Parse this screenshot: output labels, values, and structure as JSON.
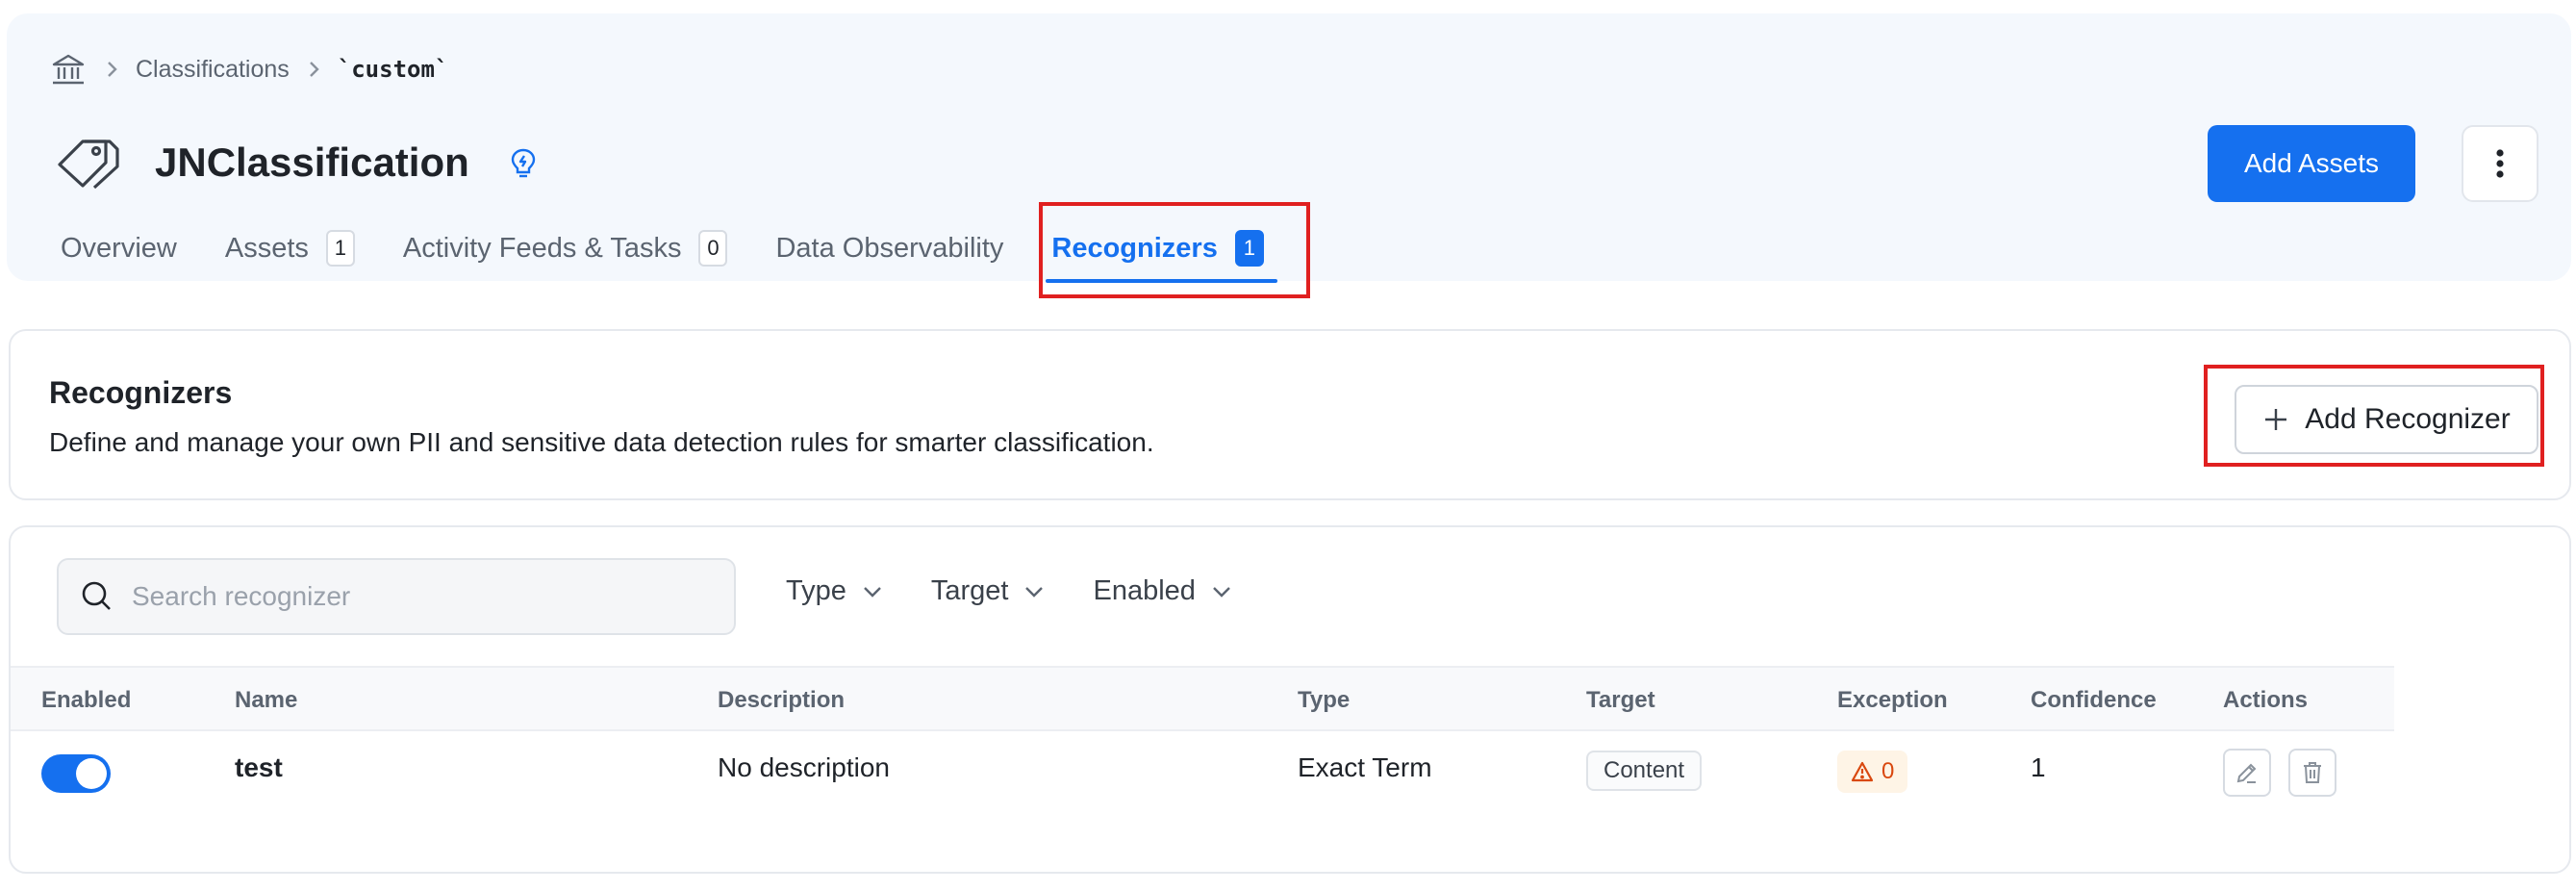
{
  "breadcrumb": {
    "items": [
      "Classifications"
    ],
    "current": "`custom`"
  },
  "page": {
    "title": "JNClassification"
  },
  "header": {
    "add_assets_label": "Add Assets"
  },
  "tabs": [
    {
      "label": "Overview"
    },
    {
      "label": "Assets",
      "count": "1"
    },
    {
      "label": "Activity Feeds & Tasks",
      "count": "0"
    },
    {
      "label": "Data Observability"
    },
    {
      "label": "Recognizers",
      "count": "1",
      "active": true
    }
  ],
  "recognizers_section": {
    "heading": "Recognizers",
    "description": "Define and manage your own PII and sensitive data detection rules for smarter classification.",
    "add_button_label": "Add Recognizer"
  },
  "search": {
    "placeholder": "Search recognizer",
    "value": ""
  },
  "filters": [
    {
      "label": "Type"
    },
    {
      "label": "Target"
    },
    {
      "label": "Enabled"
    }
  ],
  "table": {
    "columns": [
      "Enabled",
      "Name",
      "Description",
      "Type",
      "Target",
      "Exception",
      "Confidence",
      "Actions"
    ],
    "rows": [
      {
        "enabled": true,
        "name": "test",
        "description": "No description",
        "type": "Exact Term",
        "target": "Content",
        "exception": "0",
        "confidence": "1"
      }
    ]
  },
  "colors": {
    "accent": "#1570ef",
    "highlight_box": "#e02020",
    "exception_text": "#d9480f",
    "header_bg": "#f4f8fd"
  },
  "icons": {
    "home": "bank-building-icon",
    "breadcrumb_separator": "chevron-right-icon",
    "classification": "tag-icon",
    "bulb": "lightbulb-icon",
    "more": "vertical-ellipsis-icon",
    "search": "search-icon",
    "filter": "chevron-down-icon",
    "add": "plus-icon",
    "warning": "warning-triangle-icon",
    "edit": "pencil-icon",
    "delete": "trash-icon"
  }
}
